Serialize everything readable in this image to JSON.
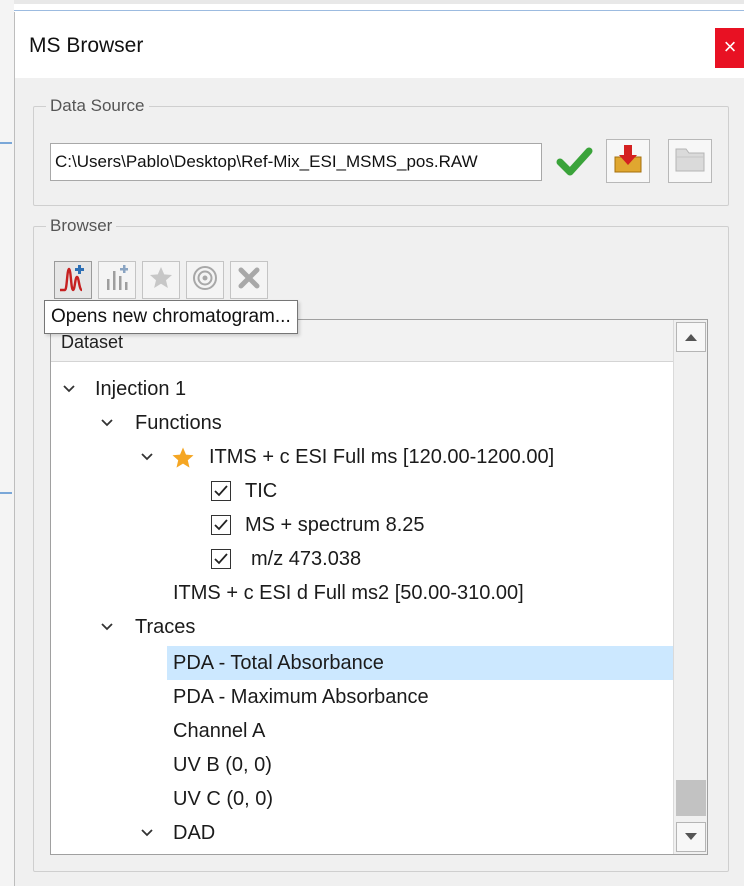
{
  "window": {
    "title": "MS Browser",
    "close_glyph": "×"
  },
  "data_source": {
    "label": "Data Source",
    "path": "C:\\Users\\Pablo\\Desktop\\Ref-Mix_ESI_MSMS_pos.RAW",
    "icons": [
      "checkmark-icon",
      "import-icon",
      "folder-icon"
    ]
  },
  "browser": {
    "label": "Browser",
    "toolbar_icons": [
      "new-chromatogram-icon",
      "new-spectrum-icon",
      "star-icon",
      "target-icon",
      "remove-icon"
    ],
    "tooltip": "Opens new chromatogram...",
    "tree_header": "Dataset",
    "tree": {
      "injection": "Injection 1",
      "functions_label": "Functions",
      "function_1": "ITMS + c ESI Full ms [120.00-1200.00]",
      "tic": "TIC",
      "ms_spectrum": "MS + spectrum 8.25",
      "mz": "m/z 473.038",
      "function_2": "ITMS + c ESI d Full ms2 [50.00-310.00]",
      "traces_label": "Traces",
      "trace_1": "PDA - Total Absorbance",
      "trace_2": "PDA - Maximum Absorbance",
      "trace_3": "Channel A",
      "trace_4": "UV B (0, 0)",
      "trace_5": "UV C (0, 0)",
      "dad_label": "DAD"
    }
  },
  "colors": {
    "accent_selection": "#cce8ff",
    "close_red": "#e81123",
    "star_orange": "#f5a623",
    "check_green": "#3aa33a"
  }
}
